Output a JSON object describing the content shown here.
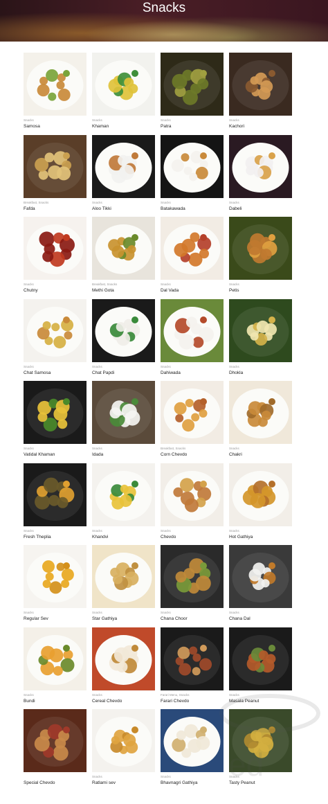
{
  "page": {
    "title": "Snacks"
  },
  "items": [
    {
      "category": "Snacks",
      "name": "Samosa",
      "colors": [
        "#f4f1ea",
        "#c98a3a",
        "#7aa43a"
      ],
      "plate": "white"
    },
    {
      "category": "Snacks",
      "name": "Khaman",
      "colors": [
        "#f2f2ee",
        "#e0c23a",
        "#3f8f3a"
      ],
      "plate": "white"
    },
    {
      "category": "Snacks",
      "name": "Patra",
      "colors": [
        "#2e2a18",
        "#6d7a28",
        "#a0a040"
      ],
      "plate": "dark"
    },
    {
      "category": "Snacks",
      "name": "Kachori",
      "colors": [
        "#3a2a20",
        "#d49a55",
        "#8a5a30"
      ],
      "plate": "dark"
    },
    {
      "category": "Breakfast, Snacks",
      "name": "Fafda",
      "colors": [
        "#5a3e28",
        "#e2c27a",
        "#caa050"
      ],
      "plate": "dark"
    },
    {
      "category": "Snacks",
      "name": "Aloo Tikki",
      "colors": [
        "#1a1a1a",
        "#f2f2f0",
        "#c07a3a"
      ],
      "plate": "white"
    },
    {
      "category": "Snacks",
      "name": "Batakawada",
      "colors": [
        "#141414",
        "#f4f2ee",
        "#c98a3a"
      ],
      "plate": "white"
    },
    {
      "category": "Snacks",
      "name": "Dabeli",
      "colors": [
        "#2a1a22",
        "#f2f0f0",
        "#d9a24a"
      ],
      "plate": "white"
    },
    {
      "category": "Snacks",
      "name": "Chutny",
      "colors": [
        "#f6f2ee",
        "#8a1a12",
        "#c03a20"
      ],
      "plate": "white"
    },
    {
      "category": "Breakfast, Snacks",
      "name": "Methi Gota",
      "colors": [
        "#e8e4dc",
        "#c9922f",
        "#6a8a2a"
      ],
      "plate": "white"
    },
    {
      "category": "Snacks",
      "name": "Dal Vada",
      "colors": [
        "#f2ece4",
        "#d2782a",
        "#b4402a"
      ],
      "plate": "white"
    },
    {
      "category": "Snacks",
      "name": "Petis",
      "colors": [
        "#3a4a1a",
        "#c07a30",
        "#e0a040"
      ],
      "plate": "dark"
    },
    {
      "category": "Snacks",
      "name": "Chat Samosa",
      "colors": [
        "#f4f2ee",
        "#d6b042",
        "#c98a3a"
      ],
      "plate": "white"
    },
    {
      "category": "Snacks",
      "name": "Chat Papdi",
      "colors": [
        "#1a1a1a",
        "#f0eee8",
        "#3a8a3a"
      ],
      "plate": "white"
    },
    {
      "category": "Snacks",
      "name": "Dahiwada",
      "colors": [
        "#6a8a3a",
        "#f4f2ee",
        "#b44a2a"
      ],
      "plate": "white"
    },
    {
      "category": "Snacks",
      "name": "Dhokla",
      "colors": [
        "#2e4a1e",
        "#f0e6b0",
        "#d4b24a"
      ],
      "plate": "dark"
    },
    {
      "category": "Snacks",
      "name": "Vatidal Khaman",
      "colors": [
        "#1a1a1a",
        "#e8c23a",
        "#4a8a2a"
      ],
      "plate": "dark"
    },
    {
      "category": "Snacks",
      "name": "Idada",
      "colors": [
        "#5a4a3a",
        "#f4f4f2",
        "#4a8a3a"
      ],
      "plate": "dark"
    },
    {
      "category": "Breakfast, Snacks",
      "name": "Corn Chevdo",
      "colors": [
        "#f2ece4",
        "#e0a040",
        "#b4602a"
      ],
      "plate": "white"
    },
    {
      "category": "Snacks",
      "name": "Chakri",
      "colors": [
        "#f0e8da",
        "#c98a3a",
        "#a06a2a"
      ],
      "plate": "white"
    },
    {
      "category": "Snacks",
      "name": "Fresh Theplia",
      "colors": [
        "#1a1a1a",
        "#6a5a2a",
        "#e0a030"
      ],
      "plate": "dark"
    },
    {
      "category": "Snacks",
      "name": "Khandvi",
      "colors": [
        "#f4f2ee",
        "#e8c23a",
        "#3a8a3a"
      ],
      "plate": "white"
    },
    {
      "category": "Snacks",
      "name": "Chevdo",
      "colors": [
        "#f2eee8",
        "#c07a3a",
        "#d4a24a"
      ],
      "plate": "white"
    },
    {
      "category": "Snacks",
      "name": "Hot Gathiya",
      "colors": [
        "#f2eee8",
        "#d4962a",
        "#b4702a"
      ],
      "plate": "white"
    },
    {
      "category": "Snacks",
      "name": "Regular Sev",
      "colors": [
        "#f6f4f0",
        "#e8a820",
        "#d4901a"
      ],
      "plate": "white"
    },
    {
      "category": "Snacks",
      "name": "Star Gathiya",
      "colors": [
        "#f0e4c8",
        "#d8b060",
        "#c09040"
      ],
      "plate": "white"
    },
    {
      "category": "Snacks",
      "name": "Chana Choor",
      "colors": [
        "#2a2a2a",
        "#c08a3a",
        "#7a9a3a"
      ],
      "plate": "dark"
    },
    {
      "category": "Snacks",
      "name": "Chana Dal",
      "colors": [
        "#3a3a3a",
        "#f2f2f0",
        "#c07a2a"
      ],
      "plate": "dark"
    },
    {
      "category": "Snacks",
      "name": "Bundi",
      "colors": [
        "#f4f0e8",
        "#e8a030",
        "#6a8a2a"
      ],
      "plate": "white"
    },
    {
      "category": "Snacks",
      "name": "Cereal Chevdo",
      "colors": [
        "#c04a2a",
        "#f2e8d8",
        "#c08a3a"
      ],
      "plate": "white"
    },
    {
      "category": "Farari Menu, Snacks",
      "name": "Farari Chevdo",
      "colors": [
        "#1a1a1a",
        "#a04a2a",
        "#d09a5a"
      ],
      "plate": "dark"
    },
    {
      "category": "Snacks",
      "name": "Masala Peanut",
      "colors": [
        "#1a1a1a",
        "#b45a2a",
        "#6a8a3a"
      ],
      "plate": "dark"
    },
    {
      "category": "",
      "name": "Special Chevdo",
      "colors": [
        "#5a2a1a",
        "#c98a4a",
        "#a03a2a"
      ],
      "plate": "dark"
    },
    {
      "category": "Snacks",
      "name": "Ratlami sev",
      "colors": [
        "#f4f2ee",
        "#e0a440",
        "#c88a2a"
      ],
      "plate": "white"
    },
    {
      "category": "Snacks",
      "name": "Bhavnagri Gathiya",
      "colors": [
        "#2a4a7a",
        "#f0e8d8",
        "#d0b070"
      ],
      "plate": "white"
    },
    {
      "category": "Snacks",
      "name": "Tasty Peanut",
      "colors": [
        "#3a4a2a",
        "#d4b040",
        "#b08a30"
      ],
      "plate": "dark"
    }
  ]
}
